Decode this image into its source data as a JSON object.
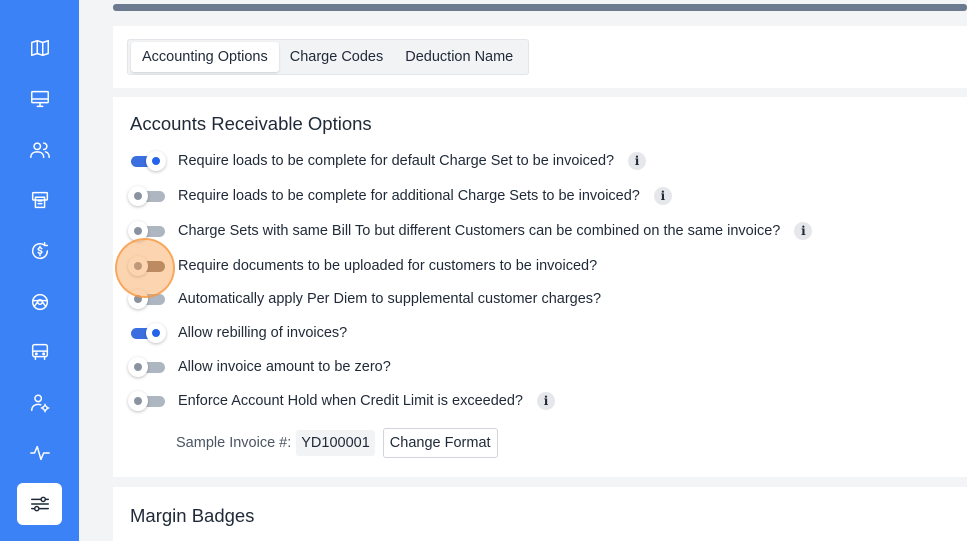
{
  "sidebar": {
    "items": [
      {
        "icon": "map-icon"
      },
      {
        "icon": "monitor-icon"
      },
      {
        "icon": "users-icon"
      },
      {
        "icon": "printer-icon"
      },
      {
        "icon": "dollar-cycle-icon"
      },
      {
        "icon": "steering-wheel-icon"
      },
      {
        "icon": "truck-icon"
      },
      {
        "icon": "user-settings-icon"
      },
      {
        "icon": "activity-icon"
      },
      {
        "icon": "sliders-icon",
        "active": true
      }
    ],
    "accent_color": "#3b82f6"
  },
  "tabs": [
    {
      "label": "Accounting Options",
      "active": true
    },
    {
      "label": "Charge Codes"
    },
    {
      "label": "Deduction Name"
    }
  ],
  "accounts_receivable": {
    "title": "Accounts Receivable Options",
    "options": [
      {
        "label": "Require loads to be complete for default Charge Set to be invoiced?",
        "enabled": true,
        "info": true
      },
      {
        "label": "Require loads to be complete for additional Charge Sets to be invoiced?",
        "enabled": false,
        "info": true
      },
      {
        "label": "Charge Sets with same Bill To but different Customers can be combined on the same invoice?",
        "enabled": false,
        "info": true
      },
      {
        "label": "Require documents to be uploaded for customers to be invoiced?",
        "enabled": false,
        "info": false
      },
      {
        "label": "Automatically apply Per Diem to supplemental customer charges?",
        "enabled": false,
        "info": false
      },
      {
        "label": "Allow rebilling of invoices?",
        "enabled": true,
        "info": false
      },
      {
        "label": "Allow invoice amount to be zero?",
        "enabled": false,
        "info": false
      },
      {
        "label": "Enforce Account Hold when Credit Limit is exceeded?",
        "enabled": false,
        "info": true
      }
    ],
    "sample_invoice_label": "Sample Invoice #:",
    "sample_invoice_value": "YD100001",
    "change_format_label": "Change Format"
  },
  "margin_badges": {
    "title": "Margin Badges"
  },
  "info_glyph": "i"
}
